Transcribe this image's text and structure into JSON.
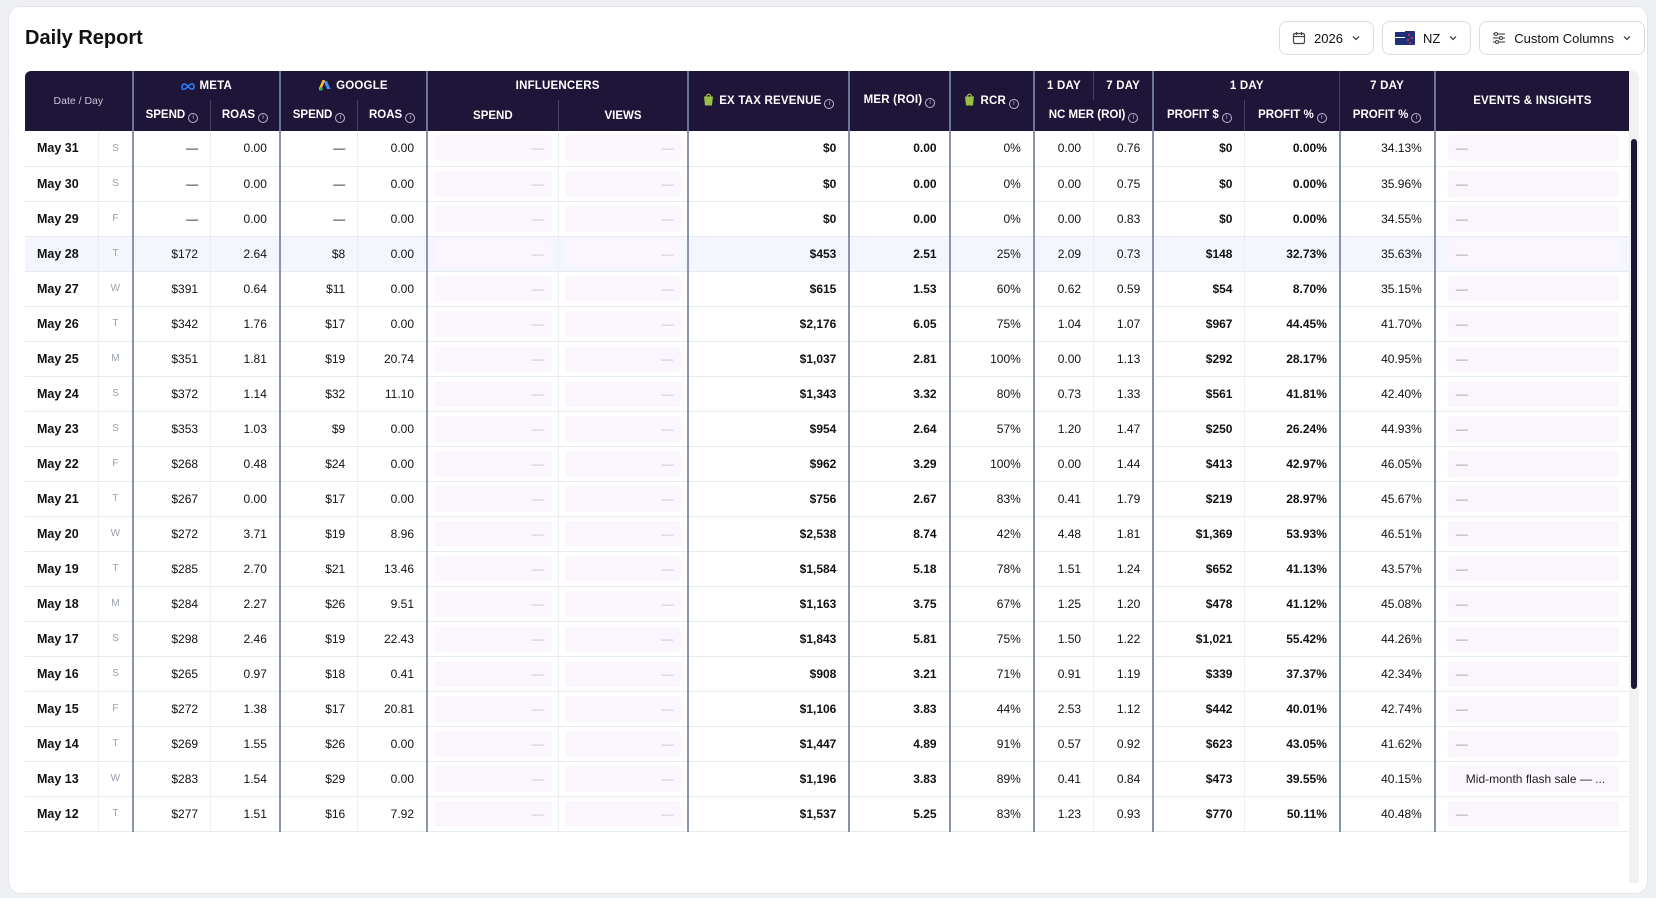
{
  "title": "Daily Report",
  "controls": {
    "year": "2026",
    "region": "NZ",
    "columns": "Custom Columns"
  },
  "headers": {
    "date_day": "Date / Day",
    "meta": "META",
    "google": "GOOGLE",
    "influencers": "INFLUENCERS",
    "ex_tax_revenue": "EX TAX REVENUE",
    "mer": "MER (ROI)",
    "rcr": "RCR",
    "one_day": "1 DAY",
    "seven_day": "7 DAY",
    "nc_mer": "NC MER (ROI)",
    "events": "EVENTS & INSIGHTS",
    "spend": "SPEND",
    "roas": "ROAS",
    "views": "VIEWS",
    "profit_usd": "PROFIT $",
    "profit_pct": "PROFIT %"
  },
  "rows": [
    {
      "date": "May 31",
      "dow": "S",
      "meta_spend": "—",
      "meta_roas": "0.00",
      "g_spend": "—",
      "g_roas": "0.00",
      "inf_spend": "—",
      "inf_views": "—",
      "rev": "$0",
      "mer": "0.00",
      "rcr": "0%",
      "nc1": "0.00",
      "nc7": "0.76",
      "profit": "$0",
      "profit_pct": "0.00%",
      "profit7": "34.13%",
      "events": "—"
    },
    {
      "date": "May 30",
      "dow": "S",
      "meta_spend": "—",
      "meta_roas": "0.00",
      "g_spend": "—",
      "g_roas": "0.00",
      "inf_spend": "—",
      "inf_views": "—",
      "rev": "$0",
      "mer": "0.00",
      "rcr": "0%",
      "nc1": "0.00",
      "nc7": "0.75",
      "profit": "$0",
      "profit_pct": "0.00%",
      "profit7": "35.96%",
      "events": "—"
    },
    {
      "date": "May 29",
      "dow": "F",
      "meta_spend": "—",
      "meta_roas": "0.00",
      "g_spend": "—",
      "g_roas": "0.00",
      "inf_spend": "—",
      "inf_views": "—",
      "rev": "$0",
      "mer": "0.00",
      "rcr": "0%",
      "nc1": "0.00",
      "nc7": "0.83",
      "profit": "$0",
      "profit_pct": "0.00%",
      "profit7": "34.55%",
      "events": "—"
    },
    {
      "date": "May 28",
      "dow": "T",
      "meta_spend": "$172",
      "meta_roas": "2.64",
      "g_spend": "$8",
      "g_roas": "0.00",
      "inf_spend": "—",
      "inf_views": "—",
      "rev": "$453",
      "mer": "2.51",
      "rcr": "25%",
      "nc1": "2.09",
      "nc7": "0.73",
      "profit": "$148",
      "profit_pct": "32.73%",
      "profit7": "35.63%",
      "events": "—"
    },
    {
      "date": "May 27",
      "dow": "W",
      "meta_spend": "$391",
      "meta_roas": "0.64",
      "g_spend": "$11",
      "g_roas": "0.00",
      "inf_spend": "—",
      "inf_views": "—",
      "rev": "$615",
      "mer": "1.53",
      "rcr": "60%",
      "nc1": "0.62",
      "nc7": "0.59",
      "profit": "$54",
      "profit_pct": "8.70%",
      "profit7": "35.15%",
      "events": "—"
    },
    {
      "date": "May 26",
      "dow": "T",
      "meta_spend": "$342",
      "meta_roas": "1.76",
      "g_spend": "$17",
      "g_roas": "0.00",
      "inf_spend": "—",
      "inf_views": "—",
      "rev": "$2,176",
      "mer": "6.05",
      "rcr": "75%",
      "nc1": "1.04",
      "nc7": "1.07",
      "profit": "$967",
      "profit_pct": "44.45%",
      "profit7": "41.70%",
      "events": "—"
    },
    {
      "date": "May 25",
      "dow": "M",
      "meta_spend": "$351",
      "meta_roas": "1.81",
      "g_spend": "$19",
      "g_roas": "20.74",
      "inf_spend": "—",
      "inf_views": "—",
      "rev": "$1,037",
      "mer": "2.81",
      "rcr": "100%",
      "nc1": "0.00",
      "nc7": "1.13",
      "profit": "$292",
      "profit_pct": "28.17%",
      "profit7": "40.95%",
      "events": "—"
    },
    {
      "date": "May 24",
      "dow": "S",
      "meta_spend": "$372",
      "meta_roas": "1.14",
      "g_spend": "$32",
      "g_roas": "11.10",
      "inf_spend": "—",
      "inf_views": "—",
      "rev": "$1,343",
      "mer": "3.32",
      "rcr": "80%",
      "nc1": "0.73",
      "nc7": "1.33",
      "profit": "$561",
      "profit_pct": "41.81%",
      "profit7": "42.40%",
      "events": "—"
    },
    {
      "date": "May 23",
      "dow": "S",
      "meta_spend": "$353",
      "meta_roas": "1.03",
      "g_spend": "$9",
      "g_roas": "0.00",
      "inf_spend": "—",
      "inf_views": "—",
      "rev": "$954",
      "mer": "2.64",
      "rcr": "57%",
      "nc1": "1.20",
      "nc7": "1.47",
      "profit": "$250",
      "profit_pct": "26.24%",
      "profit7": "44.93%",
      "events": "—"
    },
    {
      "date": "May 22",
      "dow": "F",
      "meta_spend": "$268",
      "meta_roas": "0.48",
      "g_spend": "$24",
      "g_roas": "0.00",
      "inf_spend": "—",
      "inf_views": "—",
      "rev": "$962",
      "mer": "3.29",
      "rcr": "100%",
      "nc1": "0.00",
      "nc7": "1.44",
      "profit": "$413",
      "profit_pct": "42.97%",
      "profit7": "46.05%",
      "events": "—"
    },
    {
      "date": "May 21",
      "dow": "T",
      "meta_spend": "$267",
      "meta_roas": "0.00",
      "g_spend": "$17",
      "g_roas": "0.00",
      "inf_spend": "—",
      "inf_views": "—",
      "rev": "$756",
      "mer": "2.67",
      "rcr": "83%",
      "nc1": "0.41",
      "nc7": "1.79",
      "profit": "$219",
      "profit_pct": "28.97%",
      "profit7": "45.67%",
      "events": "—"
    },
    {
      "date": "May 20",
      "dow": "W",
      "meta_spend": "$272",
      "meta_roas": "3.71",
      "g_spend": "$19",
      "g_roas": "8.96",
      "inf_spend": "—",
      "inf_views": "—",
      "rev": "$2,538",
      "mer": "8.74",
      "rcr": "42%",
      "nc1": "4.48",
      "nc7": "1.81",
      "profit": "$1,369",
      "profit_pct": "53.93%",
      "profit7": "46.51%",
      "events": "—"
    },
    {
      "date": "May 19",
      "dow": "T",
      "meta_spend": "$285",
      "meta_roas": "2.70",
      "g_spend": "$21",
      "g_roas": "13.46",
      "inf_spend": "—",
      "inf_views": "—",
      "rev": "$1,584",
      "mer": "5.18",
      "rcr": "78%",
      "nc1": "1.51",
      "nc7": "1.24",
      "profit": "$652",
      "profit_pct": "41.13%",
      "profit7": "43.57%",
      "events": "—"
    },
    {
      "date": "May 18",
      "dow": "M",
      "meta_spend": "$284",
      "meta_roas": "2.27",
      "g_spend": "$26",
      "g_roas": "9.51",
      "inf_spend": "—",
      "inf_views": "—",
      "rev": "$1,163",
      "mer": "3.75",
      "rcr": "67%",
      "nc1": "1.25",
      "nc7": "1.20",
      "profit": "$478",
      "profit_pct": "41.12%",
      "profit7": "45.08%",
      "events": "—"
    },
    {
      "date": "May 17",
      "dow": "S",
      "meta_spend": "$298",
      "meta_roas": "2.46",
      "g_spend": "$19",
      "g_roas": "22.43",
      "inf_spend": "—",
      "inf_views": "—",
      "rev": "$1,843",
      "mer": "5.81",
      "rcr": "75%",
      "nc1": "1.50",
      "nc7": "1.22",
      "profit": "$1,021",
      "profit_pct": "55.42%",
      "profit7": "44.26%",
      "events": "—"
    },
    {
      "date": "May 16",
      "dow": "S",
      "meta_spend": "$265",
      "meta_roas": "0.97",
      "g_spend": "$18",
      "g_roas": "0.41",
      "inf_spend": "—",
      "inf_views": "—",
      "rev": "$908",
      "mer": "3.21",
      "rcr": "71%",
      "nc1": "0.91",
      "nc7": "1.19",
      "profit": "$339",
      "profit_pct": "37.37%",
      "profit7": "42.34%",
      "events": "—"
    },
    {
      "date": "May 15",
      "dow": "F",
      "meta_spend": "$272",
      "meta_roas": "1.38",
      "g_spend": "$17",
      "g_roas": "20.81",
      "inf_spend": "—",
      "inf_views": "—",
      "rev": "$1,106",
      "mer": "3.83",
      "rcr": "44%",
      "nc1": "2.53",
      "nc7": "1.12",
      "profit": "$442",
      "profit_pct": "40.01%",
      "profit7": "42.74%",
      "events": "—"
    },
    {
      "date": "May 14",
      "dow": "T",
      "meta_spend": "$269",
      "meta_roas": "1.55",
      "g_spend": "$26",
      "g_roas": "0.00",
      "inf_spend": "—",
      "inf_views": "—",
      "rev": "$1,447",
      "mer": "4.89",
      "rcr": "91%",
      "nc1": "0.57",
      "nc7": "0.92",
      "profit": "$623",
      "profit_pct": "43.05%",
      "profit7": "41.62%",
      "events": "—"
    },
    {
      "date": "May 13",
      "dow": "W",
      "meta_spend": "$283",
      "meta_roas": "1.54",
      "g_spend": "$29",
      "g_roas": "0.00",
      "inf_spend": "—",
      "inf_views": "—",
      "rev": "$1,196",
      "mer": "3.83",
      "rcr": "89%",
      "nc1": "0.41",
      "nc7": "0.84",
      "profit": "$473",
      "profit_pct": "39.55%",
      "profit7": "40.15%",
      "events": "Mid-month flash sale — ..."
    },
    {
      "date": "May 12",
      "dow": "T",
      "meta_spend": "$277",
      "meta_roas": "1.51",
      "g_spend": "$16",
      "g_roas": "7.92",
      "inf_spend": "—",
      "inf_views": "—",
      "rev": "$1,537",
      "mer": "5.25",
      "rcr": "83%",
      "nc1": "1.23",
      "nc7": "0.93",
      "profit": "$770",
      "profit_pct": "50.11%",
      "profit7": "40.48%",
      "events": "—"
    }
  ]
}
